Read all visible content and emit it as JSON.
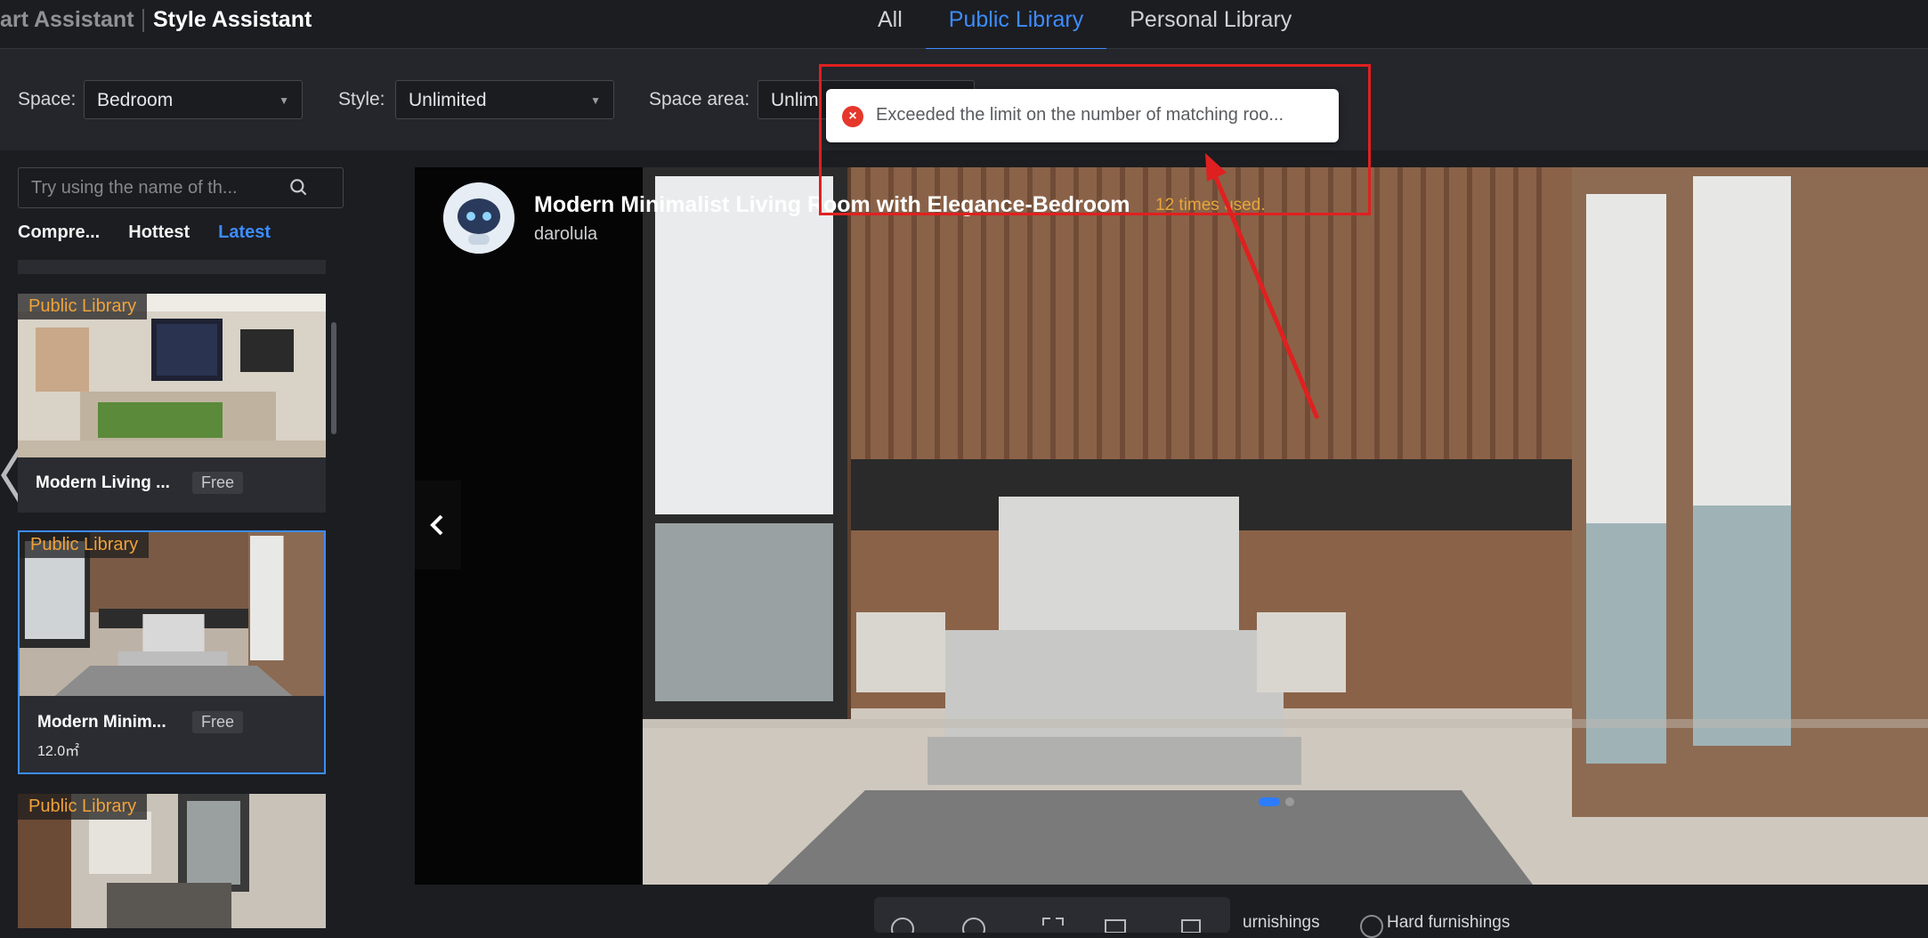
{
  "header": {
    "brand_left": "art Assistant",
    "brand_right": "Style Assistant",
    "tabs": [
      {
        "label": "All",
        "active": false
      },
      {
        "label": "Public Library",
        "active": true
      },
      {
        "label": "Personal Library",
        "active": false
      }
    ]
  },
  "filters": {
    "space": {
      "label": "Space:",
      "value": "Bedroom"
    },
    "style": {
      "label": "Style:",
      "value": "Unlimited"
    },
    "area": {
      "label": "Space area:",
      "value": "Unlimi"
    }
  },
  "sidebar": {
    "search_placeholder": "Try using the name of th...",
    "sort_tabs": [
      {
        "label": "Compre...",
        "active": false
      },
      {
        "label": "Hottest",
        "active": false
      },
      {
        "label": "Latest",
        "active": true
      }
    ],
    "cards": [
      {
        "badge": "Public Library",
        "title": "Modern Living ...",
        "price": "Free",
        "area": "",
        "selected": false
      },
      {
        "badge": "Public Library",
        "title": "Modern Minim...",
        "price": "Free",
        "area": "12.0㎡",
        "selected": true
      },
      {
        "badge": "Public Library",
        "title": "",
        "price": "",
        "area": "",
        "selected": false
      }
    ]
  },
  "viewer": {
    "title": "Modern Minimalist Living Room with Elegance-Bedroom",
    "times_used": "12 times used.",
    "author": "darolula",
    "carousel": {
      "count": 2,
      "active_index": 0
    }
  },
  "bottom_bar": {
    "soft": "urnishings",
    "hard": "Hard furnishings"
  },
  "toast": {
    "type": "error",
    "message": "Exceeded the limit on the number of matching roo..."
  },
  "colors": {
    "accent": "#3d8cff",
    "badge": "#f0a23a",
    "error": "#e5372b",
    "annotation": "#e02020"
  }
}
